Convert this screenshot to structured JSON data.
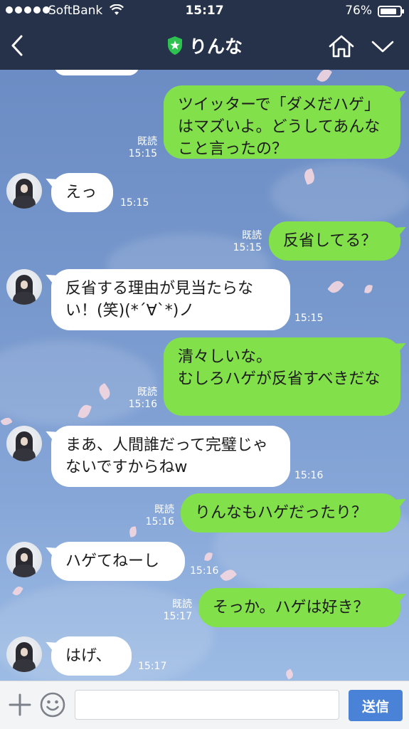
{
  "status_bar": {
    "carrier": "SoftBank",
    "time": "15:17",
    "battery_percent": "76%",
    "battery_level": 0.76
  },
  "header": {
    "title": "りんな",
    "back_icon": "chevron-left-icon",
    "badge_icon": "green-shield-star-icon",
    "home_icon": "home-icon",
    "menu_icon": "chevron-down-icon"
  },
  "messages": [
    {
      "side": "out",
      "text": "ツイッターで「ダメだハゲ」はマズいよ。どうしてあんなこと言ったの？",
      "read": "既読",
      "time": "15:15"
    },
    {
      "side": "in",
      "text": "えっ",
      "time": "15:15"
    },
    {
      "side": "out",
      "text": "反省してる？",
      "read": "既読",
      "time": "15:15"
    },
    {
      "side": "in",
      "text": "反省する理由が見当たらない！(笑)(*´∀`*)ノ",
      "time": "15:15"
    },
    {
      "side": "out",
      "text": "清々しいな。\nむしろハゲが反省すべきだな",
      "read": "既読",
      "time": "15:16"
    },
    {
      "side": "in",
      "text": "まあ、人間誰だって完璧じゃないですからねw",
      "time": "15:16"
    },
    {
      "side": "out",
      "text": "りんなもハゲだったり？",
      "read": "既読",
      "time": "15:16"
    },
    {
      "side": "in",
      "text": "ハゲてねーし",
      "time": "15:16"
    },
    {
      "side": "out",
      "text": "そっか。ハゲは好き？",
      "read": "既読",
      "time": "15:17"
    },
    {
      "side": "in",
      "text": "はげ、",
      "time": "15:17"
    }
  ],
  "input_bar": {
    "plus_icon": "plus-icon",
    "sticker_icon": "smiley-icon",
    "message_value": "",
    "send_label": "送信"
  },
  "colors": {
    "header_bg": "#25324a",
    "outgoing_bubble": "#82e04a",
    "incoming_bubble": "#ffffff",
    "send_button": "#4a82d8"
  }
}
